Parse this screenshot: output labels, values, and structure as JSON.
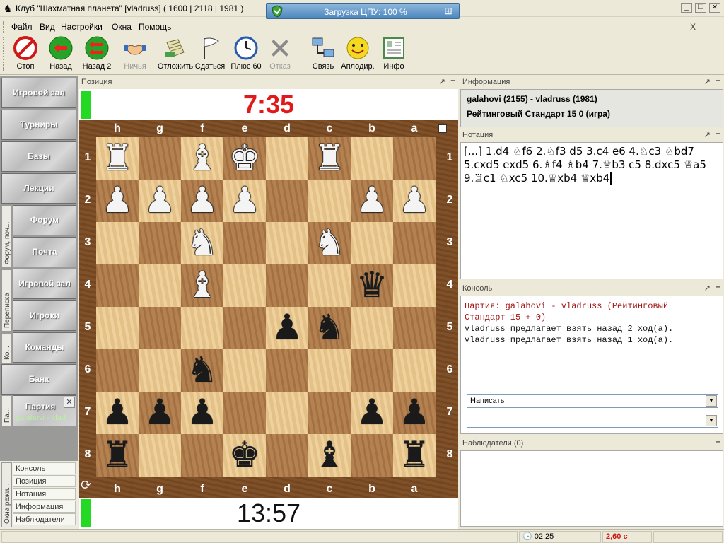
{
  "window": {
    "title": "Клуб \"Шахматная планета\" [vladruss]  ( 1600 | 2118 | 1981 )",
    "cpu_label": "Загрузка ЦПУ: 100 %"
  },
  "menu": [
    "Файл",
    "Вид",
    "Настройки",
    "Окна",
    "Помощь"
  ],
  "menu_close": "X",
  "toolbar": [
    {
      "label": "Стоп",
      "icon": "stop-icon"
    },
    {
      "label": "Назад",
      "icon": "back-icon"
    },
    {
      "label": "Назад 2",
      "icon": "back-2-icon"
    },
    {
      "label": "Ничья",
      "icon": "handshake-icon",
      "disabled": true
    },
    {
      "label": "Отложить",
      "icon": "postpone-icon"
    },
    {
      "label": "Сдаться",
      "icon": "flag-icon"
    },
    {
      "label": "Плюс 60",
      "icon": "clock-icon"
    },
    {
      "label": "Отказ",
      "icon": "reject-icon",
      "disabled": true
    },
    {
      "label": "Связь",
      "icon": "network-icon"
    },
    {
      "label": "Аплодир.",
      "icon": "smiley-icon"
    },
    {
      "label": "Инфо",
      "icon": "info-card-icon"
    }
  ],
  "nav": [
    "Игровой зал",
    "Турниры",
    "Базы",
    "Лекции",
    "Форум",
    "Почта",
    "Игровой зал",
    "Игроки",
    "Команды",
    "Банк"
  ],
  "side_tabs": [
    "Форум, поч...",
    "Переписка",
    "Ко...",
    "Па...",
    "Окна режи..."
  ],
  "party_tab": {
    "title": "Партия",
    "subtitle": "galahovi - vlad..."
  },
  "window_list": [
    "Консоль",
    "Позиция",
    "Нотация",
    "Информация",
    "Наблюдатели"
  ],
  "panels": {
    "position": "Позиция",
    "info": "Информация",
    "notation": "Нотация",
    "console": "Консоль",
    "watchers": "Наблюдатели (0)"
  },
  "clocks": {
    "top": "7:35",
    "bottom": "13:57"
  },
  "board": {
    "files": [
      "h",
      "g",
      "f",
      "e",
      "d",
      "c",
      "b",
      "a"
    ],
    "ranks": [
      "1",
      "2",
      "3",
      "4",
      "5",
      "6",
      "7",
      "8"
    ],
    "pieces": [
      {
        "file": "h",
        "rank": "1",
        "glyph": "♜",
        "color": "white"
      },
      {
        "file": "f",
        "rank": "1",
        "glyph": "♝",
        "color": "white"
      },
      {
        "file": "e",
        "rank": "1",
        "glyph": "♚",
        "color": "white"
      },
      {
        "file": "c",
        "rank": "1",
        "glyph": "♜",
        "color": "white"
      },
      {
        "file": "h",
        "rank": "2",
        "glyph": "♟",
        "color": "white"
      },
      {
        "file": "g",
        "rank": "2",
        "glyph": "♟",
        "color": "white"
      },
      {
        "file": "f",
        "rank": "2",
        "glyph": "♟",
        "color": "white"
      },
      {
        "file": "e",
        "rank": "2",
        "glyph": "♟",
        "color": "white"
      },
      {
        "file": "b",
        "rank": "2",
        "glyph": "♟",
        "color": "white"
      },
      {
        "file": "a",
        "rank": "2",
        "glyph": "♟",
        "color": "white"
      },
      {
        "file": "f",
        "rank": "3",
        "glyph": "♞",
        "color": "white"
      },
      {
        "file": "c",
        "rank": "3",
        "glyph": "♞",
        "color": "white"
      },
      {
        "file": "f",
        "rank": "4",
        "glyph": "♝",
        "color": "white"
      },
      {
        "file": "b",
        "rank": "4",
        "glyph": "♛",
        "color": "black"
      },
      {
        "file": "d",
        "rank": "5",
        "glyph": "♟",
        "color": "black"
      },
      {
        "file": "c",
        "rank": "5",
        "glyph": "♞",
        "color": "black"
      },
      {
        "file": "f",
        "rank": "6",
        "glyph": "♞",
        "color": "black"
      },
      {
        "file": "h",
        "rank": "7",
        "glyph": "♟",
        "color": "black"
      },
      {
        "file": "g",
        "rank": "7",
        "glyph": "♟",
        "color": "black"
      },
      {
        "file": "f",
        "rank": "7",
        "glyph": "♟",
        "color": "black"
      },
      {
        "file": "b",
        "rank": "7",
        "glyph": "♟",
        "color": "black"
      },
      {
        "file": "a",
        "rank": "7",
        "glyph": "♟",
        "color": "black"
      },
      {
        "file": "h",
        "rank": "8",
        "glyph": "♜",
        "color": "black"
      },
      {
        "file": "e",
        "rank": "8",
        "glyph": "♚",
        "color": "black"
      },
      {
        "file": "c",
        "rank": "8",
        "glyph": "♝",
        "color": "black"
      },
      {
        "file": "a",
        "rank": "8",
        "glyph": "♜",
        "color": "black"
      }
    ]
  },
  "info": {
    "players": "galahovi (2155) - vladruss (1981)",
    "game_type": "Рейтинговый Стандарт 15 0  (игра)"
  },
  "notation": "[...] 1.d4 ♘f6 2.♘f3 d5 3.c4 e6 4.♘c3 ♘bd7 5.cxd5 exd5 6.♗f4 ♗b4 7.♕b3 c5 8.dxc5 ♕a5 9.♖c1 ♘xc5 10.♕xb4 ♕xb4",
  "console": {
    "lines": [
      {
        "text": "Партия: galahovi - vladruss (Рейтинговый",
        "color": "#a01818"
      },
      {
        "text": "Стандарт 15 + 0)",
        "color": "#a01818"
      },
      {
        "text": "vladruss предлагает взять назад 2 ход(а).",
        "color": "#111111"
      },
      {
        "text": "vladruss предлагает взять назад 1 ход(а).",
        "color": "#111111"
      }
    ],
    "combo_send": "Написать",
    "combo_target": ""
  },
  "status": {
    "time": "02:25",
    "lag": "2,60 с"
  }
}
